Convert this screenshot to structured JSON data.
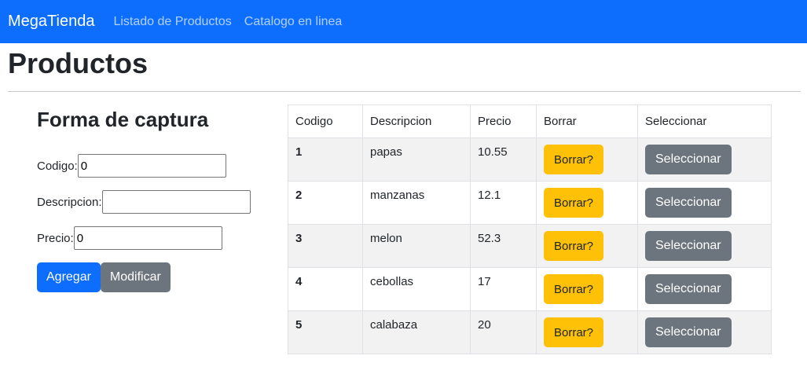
{
  "navbar": {
    "brand": "MegaTienda",
    "links": [
      "Listado de Productos",
      "Catalogo en linea"
    ]
  },
  "page": {
    "title": "Productos"
  },
  "form": {
    "title": "Forma de captura",
    "codigo_label": "Codigo:",
    "codigo_value": "0",
    "descripcion_label": "Descripcion:",
    "descripcion_value": "",
    "precio_label": "Precio:",
    "precio_value": "0",
    "add_label": "Agregar",
    "modify_label": "Modificar"
  },
  "table": {
    "headers": [
      "Codigo",
      "Descripcion",
      "Precio",
      "Borrar",
      "Seleccionar"
    ],
    "delete_label": "Borrar?",
    "select_label": "Seleccionar",
    "rows": [
      {
        "codigo": "1",
        "descripcion": "papas",
        "precio": "10.55"
      },
      {
        "codigo": "2",
        "descripcion": "manzanas",
        "precio": "12.1"
      },
      {
        "codigo": "3",
        "descripcion": "melon",
        "precio": "52.3"
      },
      {
        "codigo": "4",
        "descripcion": "cebollas",
        "precio": "17"
      },
      {
        "codigo": "5",
        "descripcion": "calabaza",
        "precio": "20"
      }
    ]
  },
  "colors": {
    "primary": "#0d6efd",
    "secondary": "#6c757d",
    "warning": "#ffc107"
  }
}
